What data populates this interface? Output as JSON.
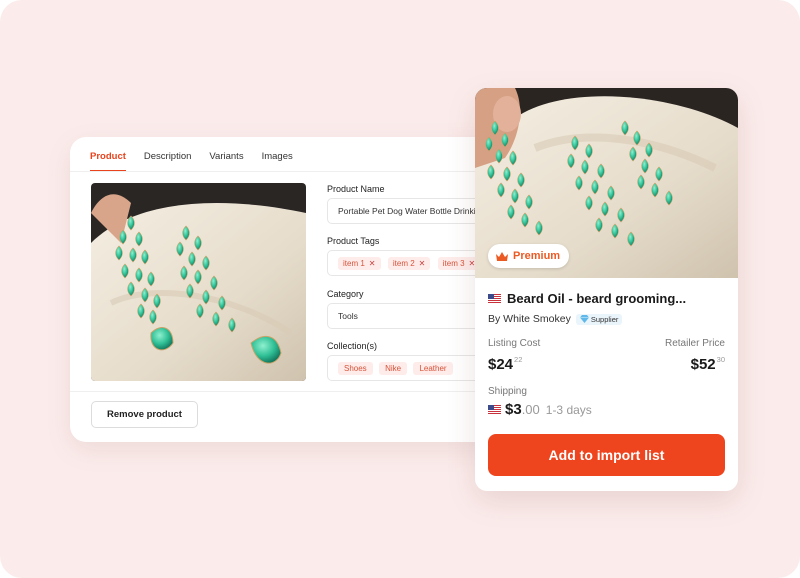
{
  "colors": {
    "accent": "#ee451e",
    "background": "#fbeceb",
    "tag_text": "#d9533a",
    "tag_bg": "#fdecea"
  },
  "editor": {
    "tabs": [
      {
        "label": "Product",
        "active": true
      },
      {
        "label": "Description",
        "active": false
      },
      {
        "label": "Variants",
        "active": false
      },
      {
        "label": "Images",
        "active": false
      }
    ],
    "product_name_label": "Product Name",
    "product_name_value": "Portable Pet Dog Water Bottle Drinking",
    "product_tags_label": "Product Tags",
    "tags": [
      "item 1",
      "item 2",
      "item 3"
    ],
    "category_label": "Category",
    "category_value": "Tools",
    "collections_label": "Collection(s)",
    "collections": [
      "Shoes",
      "Nike",
      "Leather"
    ],
    "remove_button": "Remove product"
  },
  "card": {
    "badge": "Premium",
    "badge_icon": "crown-icon",
    "flag_icon": "us-flag-icon",
    "title": "Beard Oil - beard grooming...",
    "by_text": "By White Smokey",
    "supplier_label": "Supplier",
    "supplier_icon": "diamond-icon",
    "listing_cost_label": "Listing Cost",
    "listing_cost_main": "$24",
    "listing_cost_cents": "22",
    "retailer_price_label": "Retailer Price",
    "retailer_price_main": "$52",
    "retailer_price_cents": "30",
    "shipping_label": "Shipping",
    "shipping_main": "$3",
    "shipping_cents": ".00",
    "shipping_days": "1-3 days",
    "cta": "Add to import list"
  }
}
